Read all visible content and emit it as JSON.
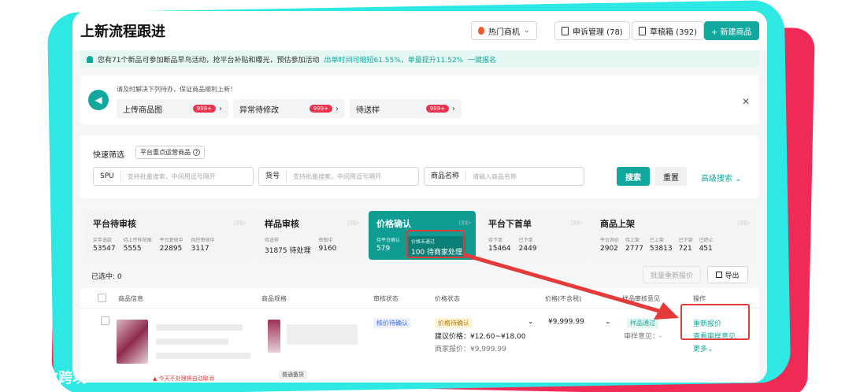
{
  "header": {
    "title": "上新流程跟进",
    "hot_btn": "热门商机",
    "appeal_btn": "申诉管理 (78)",
    "draft_btn": "草稿箱 (392)",
    "new_btn": "+ 新建商品"
  },
  "notice": {
    "text": "您有71个新品可参加断品早鸟活动，抢平台补贴和曝光，预估参加活动",
    "highlight": "出单时间可缩短61.55%，单量提升11.52%",
    "link": "一键报名"
  },
  "todo": {
    "hint": "请及时解决下列待办，保证商品顺利上新！",
    "items": [
      {
        "label": "上传商品图",
        "badge": "999+"
      },
      {
        "label": "异常待修改",
        "badge": "999+"
      },
      {
        "label": "待送样",
        "badge": "999+"
      }
    ]
  },
  "filter": {
    "quick_label": "快速筛选",
    "quick_tag": "平台重点运营商品",
    "spu_label": "SPU",
    "spu_placeholder": "支持批量搜索，中间用逗号隔开",
    "sku_label": "货号",
    "sku_placeholder": "支持批量搜索，中间用逗号隔开",
    "name_label": "商品名称",
    "name_placeholder": "请输入商品名称",
    "search": "搜索",
    "reset": "重置",
    "advanced": "高级搜索"
  },
  "stages": [
    {
      "title": "平台待审核",
      "metrics": [
        {
          "label": "买手选款",
          "value": "53547"
        },
        {
          "label": "待上传样前图",
          "value": "5555"
        },
        {
          "label": "平台复核中",
          "value": "22895"
        },
        {
          "label": "风控审核中",
          "value": "3117"
        }
      ]
    },
    {
      "title": "样品审核",
      "metrics": [
        {
          "label": "待送样",
          "value": "31875 待处理"
        },
        {
          "label": "审版中",
          "value": "9160"
        }
      ]
    },
    {
      "title": "价格确认",
      "metrics": [
        {
          "label": "待平台确认",
          "value": "579"
        },
        {
          "label": "价格未通过",
          "value": "100 待商家处理"
        }
      ]
    },
    {
      "title": "平台下首单",
      "metrics": [
        {
          "label": "待下单",
          "value": "15464"
        },
        {
          "label": "已下单",
          "value": "2449"
        }
      ]
    },
    {
      "title": "商品上架",
      "metrics": [
        {
          "label": "平台询价",
          "value": "2902"
        },
        {
          "label": "待上架",
          "value": "2777"
        },
        {
          "label": "已上架",
          "value": "53813"
        },
        {
          "label": "已下架",
          "value": "721"
        },
        {
          "label": "已终止",
          "value": "451"
        }
      ]
    }
  ],
  "toolbar": {
    "selected": "已选中: 0",
    "batch_reprice": "批量重新报价",
    "export": "导出"
  },
  "table": {
    "headers": [
      "商品信息",
      "商品规格",
      "审核状态",
      "价格状态",
      "价格(不含税)",
      "样品审核意见",
      "操作"
    ],
    "row": {
      "audit_status": "核价待确认",
      "price_status": "价格待确认",
      "suggested_price": "建议价格：¥12.60~¥18.00",
      "merchant_price": "商家报价：¥9,999.99",
      "price": "¥9,999.99",
      "sample_status": "样品通过",
      "sample_opinion": "审样意见：-",
      "action_reprice": "重新报价",
      "action_view": "查看审样意见",
      "action_more": "更多",
      "warn": "今天不处理将自动取消",
      "spec_tag": "普通备货"
    }
  },
  "watermark": "大数跨境",
  "colors": {
    "accent": "#13a89e",
    "danger": "#e53a3a",
    "frame_red": "#ee2a55",
    "frame_cyan": "#2ee9e3"
  }
}
